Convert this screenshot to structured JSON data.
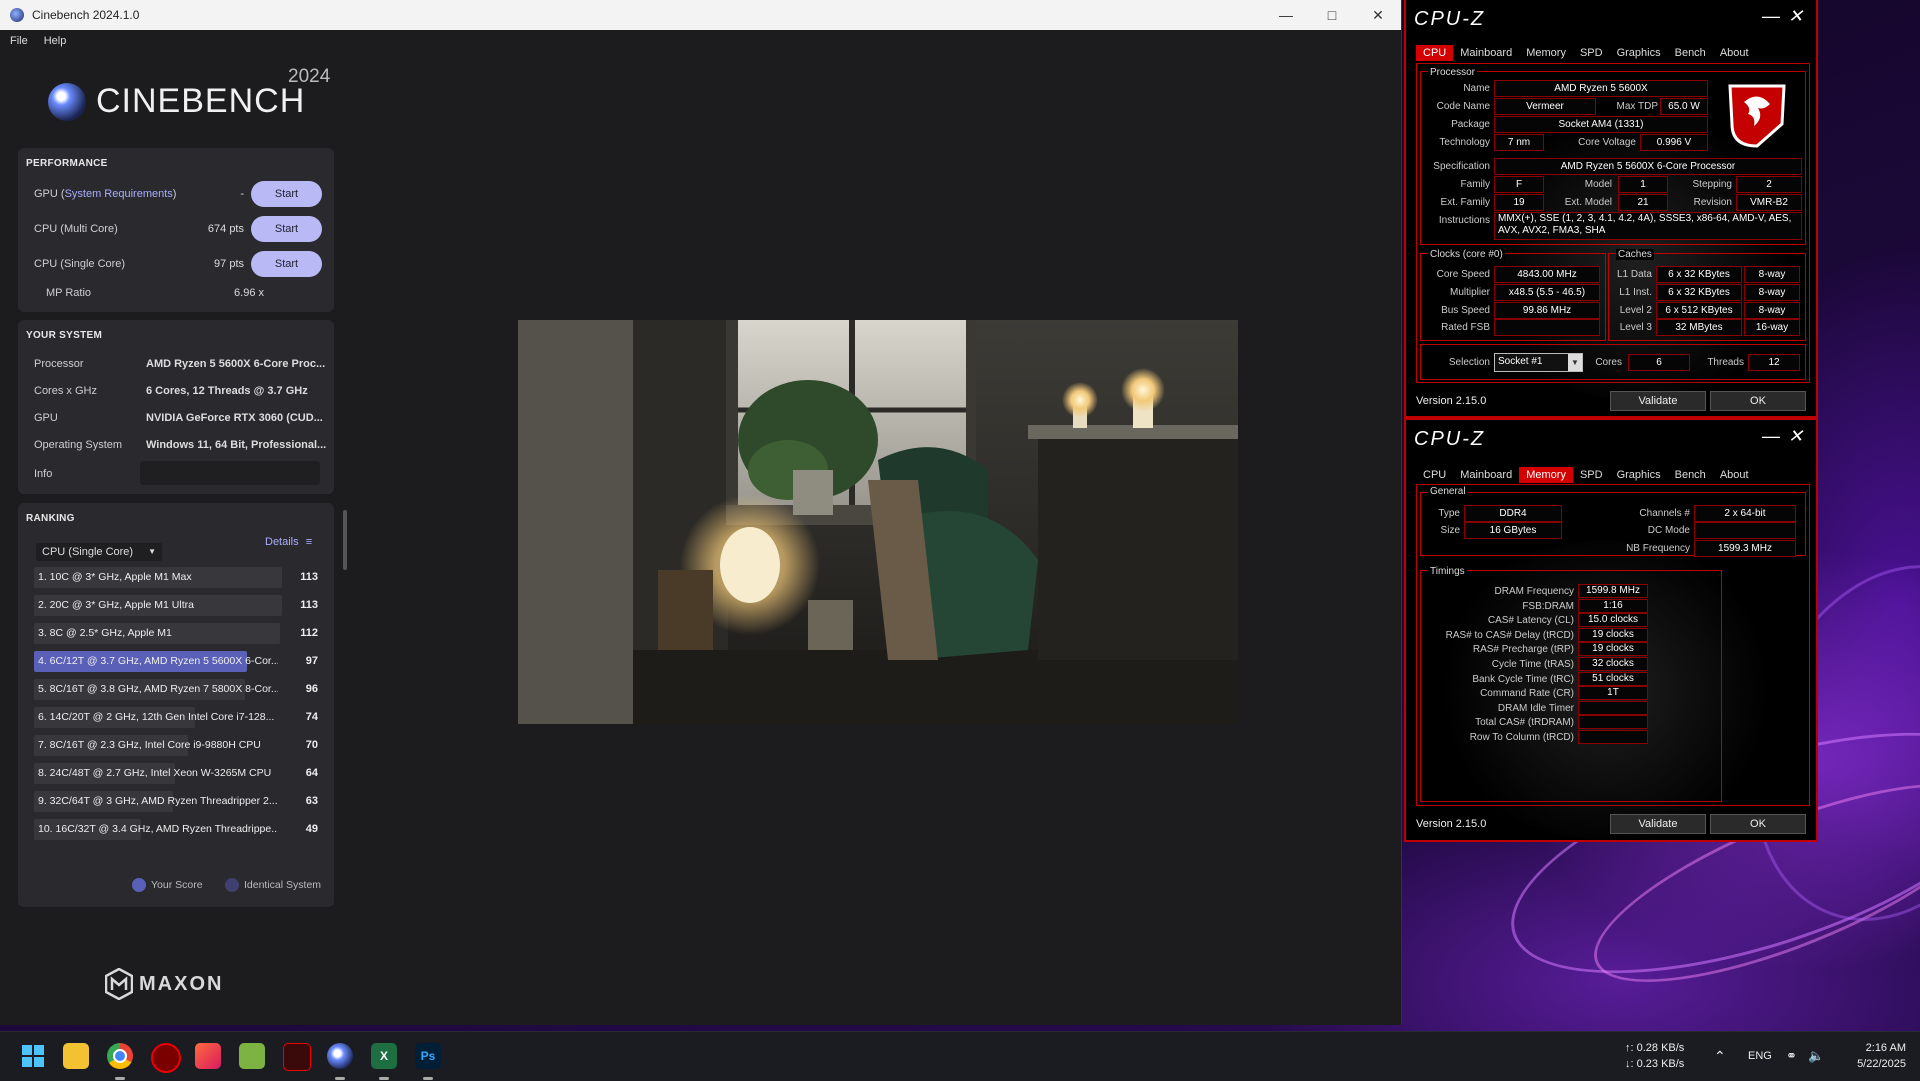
{
  "cinebench": {
    "window_title": "Cinebench 2024.1.0",
    "menu": [
      "File",
      "Help"
    ],
    "logo_text": "CINEBENCH",
    "logo_year": "2024",
    "performance": {
      "title": "PERFORMANCE",
      "rows": [
        {
          "label_prefix": "GPU (",
          "link": "System Requirements",
          "label_suffix": ")",
          "value": "-",
          "button": "Start"
        },
        {
          "label": "CPU (Multi Core)",
          "value": "674 pts",
          "button": "Start"
        },
        {
          "label": "CPU (Single Core)",
          "value": "97 pts",
          "button": "Start"
        }
      ],
      "mp_ratio_label": "MP Ratio",
      "mp_ratio_value": "6.96 x"
    },
    "your_system": {
      "title": "YOUR SYSTEM",
      "rows": [
        {
          "label": "Processor",
          "value": "AMD Ryzen 5 5600X 6-Core Proc..."
        },
        {
          "label": "Cores x GHz",
          "value": "6 Cores, 12 Threads @ 3.7 GHz"
        },
        {
          "label": "GPU",
          "value": "NVIDIA GeForce RTX 3060 (CUD..."
        },
        {
          "label": "Operating System",
          "value": "Windows 11, 64 Bit, Professional..."
        },
        {
          "label": "Info",
          "value": ""
        }
      ]
    },
    "ranking": {
      "title": "RANKING",
      "dropdown": "CPU (Single Core)",
      "details": "Details",
      "rows": [
        {
          "label": "1. 10C @ 3* GHz, Apple M1 Max",
          "score": "113",
          "fraction": 1.0,
          "highlight": false
        },
        {
          "label": "2. 20C @ 3* GHz, Apple M1 Ultra",
          "score": "113",
          "fraction": 1.0,
          "highlight": false
        },
        {
          "label": "3. 8C @ 2.5* GHz, Apple M1",
          "score": "112",
          "fraction": 0.99,
          "highlight": false
        },
        {
          "label": "4. 6C/12T @ 3.7 GHz, AMD Ryzen 5 5600X 6-Cor...",
          "score": "97",
          "fraction": 0.86,
          "highlight": true
        },
        {
          "label": "5. 8C/16T @ 3.8 GHz, AMD Ryzen 7 5800X 8-Cor...",
          "score": "96",
          "fraction": 0.85,
          "highlight": false
        },
        {
          "label": "6. 14C/20T @ 2 GHz, 12th Gen Intel Core i7-128...",
          "score": "74",
          "fraction": 0.65,
          "highlight": false
        },
        {
          "label": "7. 8C/16T @ 2.3 GHz, Intel Core i9-9880H CPU",
          "score": "70",
          "fraction": 0.62,
          "highlight": false
        },
        {
          "label": "8. 24C/48T @ 2.7 GHz, Intel Xeon W-3265M CPU",
          "score": "64",
          "fraction": 0.57,
          "highlight": false
        },
        {
          "label": "9. 32C/64T @ 3 GHz, AMD Ryzen Threadripper 2...",
          "score": "63",
          "fraction": 0.56,
          "highlight": false
        },
        {
          "label": "10. 16C/32T @ 3.4 GHz, AMD Ryzen Threadrippe...",
          "score": "49",
          "fraction": 0.43,
          "highlight": false
        }
      ],
      "legend_your_score": "Your Score",
      "legend_identical": "Identical System"
    },
    "brand": "MAXON"
  },
  "cpuz_cpu": {
    "title": "CPU-Z",
    "tabs": [
      "CPU",
      "Mainboard",
      "Memory",
      "SPD",
      "Graphics",
      "Bench",
      "About"
    ],
    "active_tab": "CPU",
    "processor_group": "Processor",
    "name_label": "Name",
    "name": "AMD Ryzen 5 5600X",
    "code_name_label": "Code Name",
    "code_name": "Vermeer",
    "max_tdp_label": "Max TDP",
    "max_tdp": "65.0 W",
    "package_label": "Package",
    "package": "Socket AM4 (1331)",
    "technology_label": "Technology",
    "technology": "7 nm",
    "core_voltage_label": "Core Voltage",
    "core_voltage": "0.996 V",
    "specification_label": "Specification",
    "specification": "AMD Ryzen 5 5600X 6-Core Processor",
    "family_label": "Family",
    "family": "F",
    "model_label": "Model",
    "model": "1",
    "stepping_label": "Stepping",
    "stepping": "2",
    "ext_family_label": "Ext. Family",
    "ext_family": "19",
    "ext_model_label": "Ext. Model",
    "ext_model": "21",
    "revision_label": "Revision",
    "revision": "VMR-B2",
    "instructions_label": "Instructions",
    "instructions": "MMX(+), SSE (1, 2, 3, 4.1, 4.2, 4A), SSSE3, x86-64, AMD-V, AES, AVX, AVX2, FMA3, SHA",
    "clocks_group": "Clocks (core #0)",
    "core_speed_label": "Core Speed",
    "core_speed": "4843.00 MHz",
    "multiplier_label": "Multiplier",
    "multiplier": "x48.5 (5.5 - 46.5)",
    "bus_speed_label": "Bus Speed",
    "bus_speed": "99.86 MHz",
    "rated_fsb_label": "Rated FSB",
    "rated_fsb": "",
    "caches_group": "Caches",
    "l1_data_label": "L1 Data",
    "l1_data": "6 x 32 KBytes",
    "l1_data_way": "8-way",
    "l1_inst_label": "L1 Inst.",
    "l1_inst": "6 x 32 KBytes",
    "l1_inst_way": "8-way",
    "level2_label": "Level 2",
    "level2": "6 x 512 KBytes",
    "level2_way": "8-way",
    "level3_label": "Level 3",
    "level3": "32 MBytes",
    "level3_way": "16-way",
    "selection_label": "Selection",
    "selection": "Socket #1",
    "cores_label": "Cores",
    "cores": "6",
    "threads_label": "Threads",
    "threads": "12",
    "version": "Version 2.15.0",
    "validate": "Validate",
    "ok": "OK"
  },
  "cpuz_mem": {
    "title": "CPU-Z",
    "tabs": [
      "CPU",
      "Mainboard",
      "Memory",
      "SPD",
      "Graphics",
      "Bench",
      "About"
    ],
    "active_tab": "Memory",
    "general_group": "General",
    "type_label": "Type",
    "type": "DDR4",
    "size_label": "Size",
    "size": "16 GBytes",
    "channels_label": "Channels #",
    "channels": "2 x 64-bit",
    "dc_mode_label": "DC Mode",
    "dc_mode": "",
    "nb_freq_label": "NB Frequency",
    "nb_freq": "1599.3 MHz",
    "timings_group": "Timings",
    "timings": [
      {
        "label": "DRAM Frequency",
        "value": "1599.8 MHz"
      },
      {
        "label": "FSB:DRAM",
        "value": "1:16"
      },
      {
        "label": "CAS# Latency (CL)",
        "value": "15.0 clocks"
      },
      {
        "label": "RAS# to CAS# Delay (tRCD)",
        "value": "19 clocks"
      },
      {
        "label": "RAS# Precharge (tRP)",
        "value": "19 clocks"
      },
      {
        "label": "Cycle Time (tRAS)",
        "value": "32 clocks"
      },
      {
        "label": "Bank Cycle Time (tRC)",
        "value": "51 clocks"
      },
      {
        "label": "Command Rate (CR)",
        "value": "1T"
      },
      {
        "label": "DRAM Idle Timer",
        "value": ""
      },
      {
        "label": "Total CAS# (tRDRAM)",
        "value": ""
      },
      {
        "label": "Row To Column (tRCD)",
        "value": ""
      }
    ],
    "version": "Version 2.15.0",
    "validate": "Validate",
    "ok": "OK"
  },
  "taskbar": {
    "net_up": "↑: 0.28 KB/s",
    "net_down": "↓: 0.23 KB/s",
    "lang": "ENG",
    "time": "2:16 AM",
    "date": "5/22/2025",
    "apps": [
      "windows-start",
      "file-explorer",
      "chrome",
      "msi-center",
      "office",
      "notepad",
      "msi-afterburner",
      "cinebench",
      "excel",
      "photoshop"
    ]
  },
  "colors": {
    "accent_red": "#d40000",
    "cb_button": "#b8b9f5",
    "cb_highlight": "#5a5fb8"
  }
}
